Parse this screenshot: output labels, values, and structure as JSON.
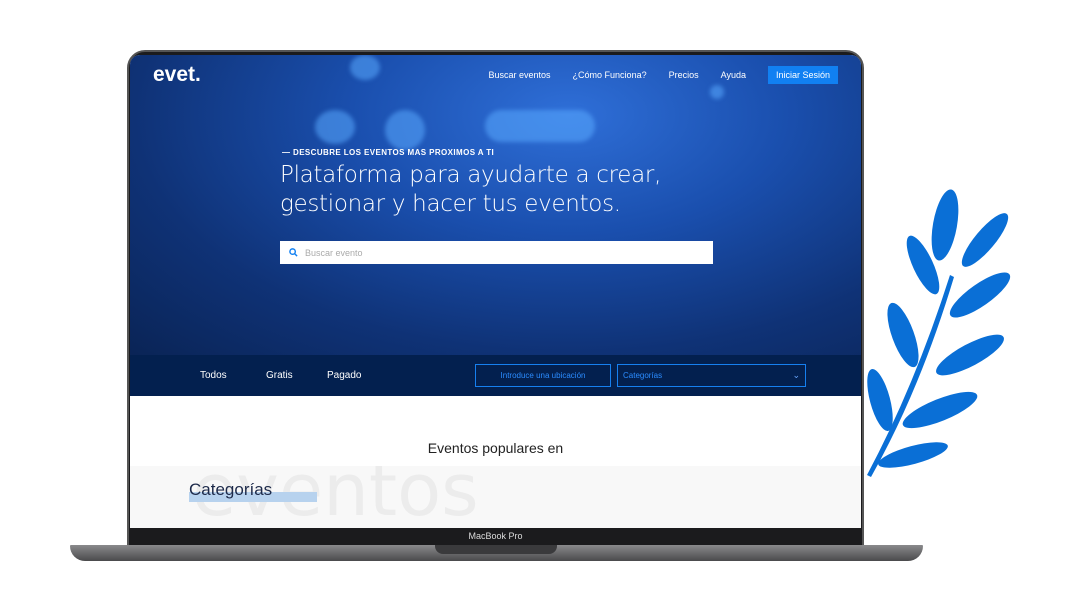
{
  "nav": {
    "logo": "evet.",
    "items": [
      "Buscar eventos",
      "¿Cómo Funciona?",
      "Precios",
      "Ayuda"
    ],
    "login": "Iniciar Sesión"
  },
  "hero": {
    "eyebrow": "— DESCUBRE LOS EVENTOS MAS PROXIMOS A TI",
    "headline_line1": "Plataforma para ayudarte a crear,",
    "headline_line2": "gestionar y hacer tus eventos.",
    "search_placeholder": "Buscar evento"
  },
  "filters": {
    "tabs": [
      "Todos",
      "Gratis",
      "Pagado"
    ],
    "location": "Introduce una ubicación",
    "category": "Categorías"
  },
  "content": {
    "popular": "Eventos populares en",
    "watermark": "eventos",
    "categories_title": "Categorías"
  },
  "device_label": "MacBook Pro",
  "colors": {
    "accent": "#1180f2",
    "filter_bg": "#03204f",
    "leaf": "#0a6fd6"
  }
}
